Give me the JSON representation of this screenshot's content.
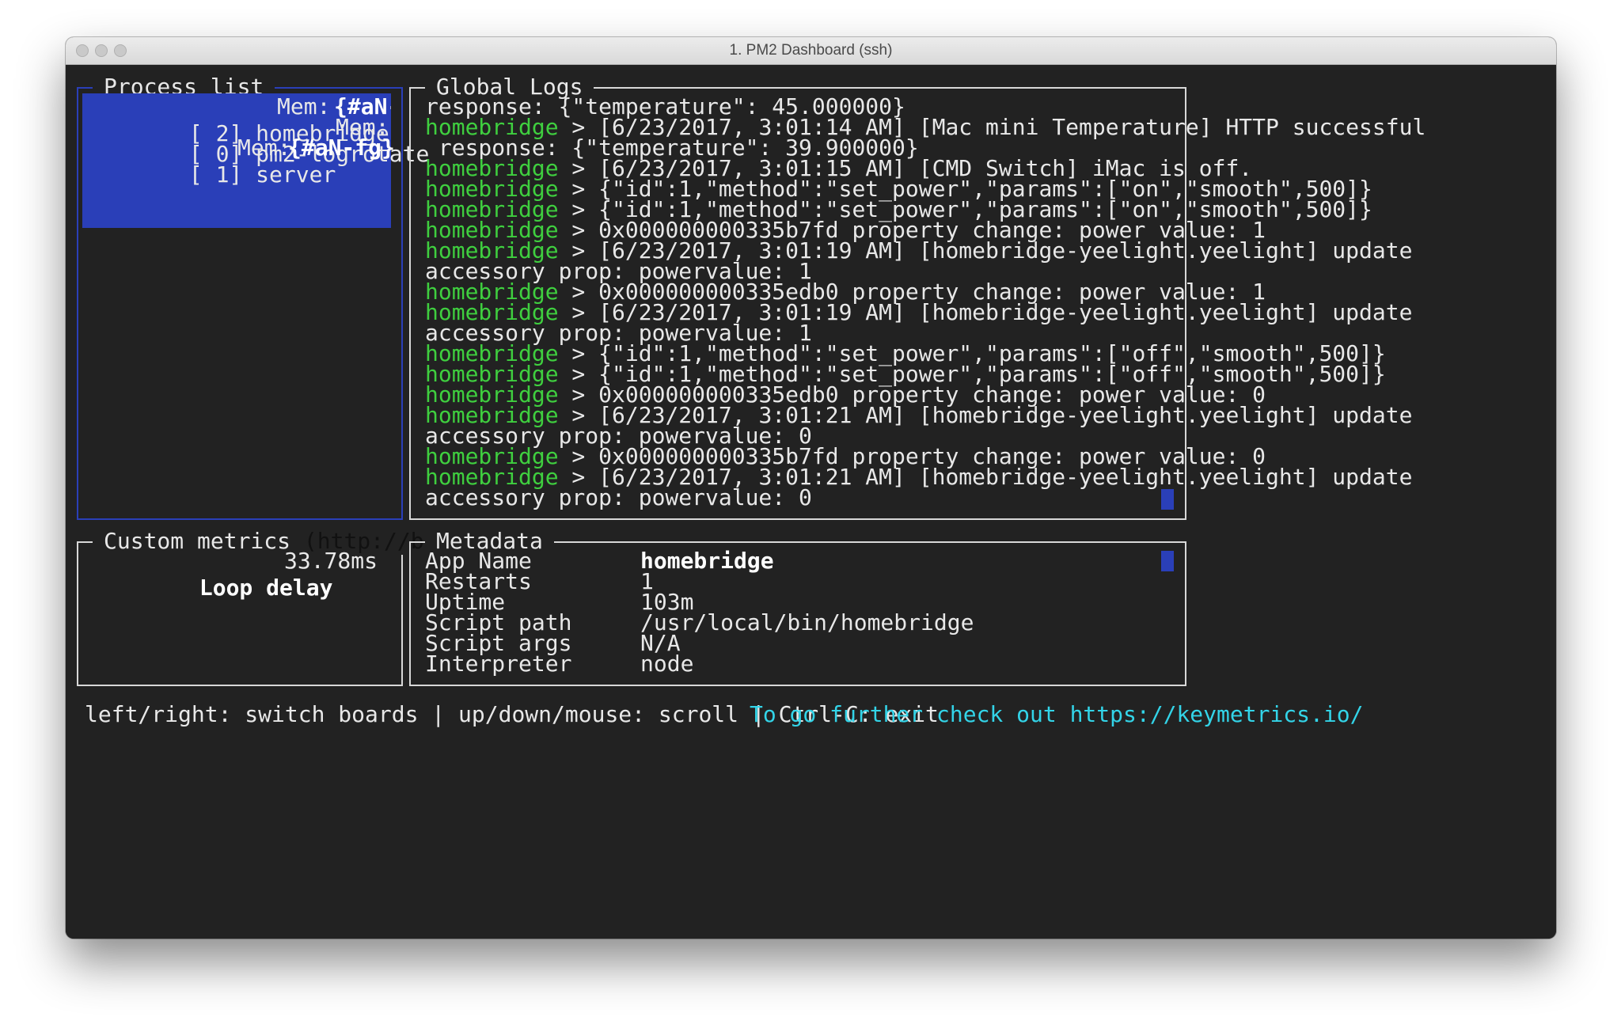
{
  "window": {
    "title": "1. PM2 Dashboard (ssh)"
  },
  "process_list": {
    "title": "Process list",
    "items": [
      {
        "id": "[ 2]",
        "name": "homebridge",
        "mem_label": "Mem:",
        "mem_value": "{#aN-f"
      },
      {
        "id": "[ 0]",
        "name": "pm2-logrotate",
        "mem_label": "Mem:",
        "mem_value": ""
      },
      {
        "id": "[ 1]",
        "name": "server",
        "mem_label": "Mem:",
        "mem_value": "{#aN-fg}"
      }
    ]
  },
  "global_logs": {
    "title": "Global Logs",
    "lines": [
      {
        "app": "",
        "text": "response: {\"temperature\": 45.000000}"
      },
      {
        "app": "homebridge",
        "text": " > [6/23/2017, 3:01:14 AM] [Mac mini Temperature] HTTP successful"
      },
      {
        "app": "",
        "text": " response: {\"temperature\": 39.900000}"
      },
      {
        "app": "homebridge",
        "text": " > [6/23/2017, 3:01:15 AM] [CMD Switch] iMac is off."
      },
      {
        "app": "homebridge",
        "text": " > {\"id\":1,\"method\":\"set_power\",\"params\":[\"on\",\"smooth\",500]}"
      },
      {
        "app": "homebridge",
        "text": " > {\"id\":1,\"method\":\"set_power\",\"params\":[\"on\",\"smooth\",500]}"
      },
      {
        "app": "homebridge",
        "text": " > 0x000000000335b7fd property change: power value: 1"
      },
      {
        "app": "homebridge",
        "text": " > [6/23/2017, 3:01:19 AM] [homebridge-yeelight.yeelight] update"
      },
      {
        "app": "",
        "text": "accessory prop: powervalue: 1"
      },
      {
        "app": "homebridge",
        "text": " > 0x000000000335edb0 property change: power value: 1"
      },
      {
        "app": "homebridge",
        "text": " > [6/23/2017, 3:01:19 AM] [homebridge-yeelight.yeelight] update"
      },
      {
        "app": "",
        "text": "accessory prop: powervalue: 1"
      },
      {
        "app": "homebridge",
        "text": " > {\"id\":1,\"method\":\"set_power\",\"params\":[\"off\",\"smooth\",500]}"
      },
      {
        "app": "homebridge",
        "text": " > {\"id\":1,\"method\":\"set_power\",\"params\":[\"off\",\"smooth\",500]}"
      },
      {
        "app": "homebridge",
        "text": " > 0x000000000335edb0 property change: power value: 0"
      },
      {
        "app": "homebridge",
        "text": " > [6/23/2017, 3:01:21 AM] [homebridge-yeelight.yeelight] update"
      },
      {
        "app": "",
        "text": "accessory prop: powervalue: 0"
      },
      {
        "app": "homebridge",
        "text": " > 0x000000000335b7fd property change: power value: 0"
      },
      {
        "app": "homebridge",
        "text": " > [6/23/2017, 3:01:21 AM] [homebridge-yeelight.yeelight] update"
      },
      {
        "app": "",
        "text": "accessory prop: powervalue: 0"
      }
    ]
  },
  "custom_metrics": {
    "title": "Custom metrics",
    "title_suffix": "(http://bit.ly",
    "items": [
      {
        "label": "Loop delay",
        "value": "33.78ms"
      }
    ]
  },
  "metadata": {
    "title": "Metadata",
    "rows": [
      {
        "key": "App Name",
        "value": "homebridge"
      },
      {
        "key": "Restarts",
        "value": "1"
      },
      {
        "key": "Uptime",
        "value": "103m"
      },
      {
        "key": "Script path",
        "value": "/usr/local/bin/homebridge"
      },
      {
        "key": "Script args",
        "value": "N/A"
      },
      {
        "key": "Interpreter",
        "value": "node"
      }
    ]
  },
  "footer": {
    "help": "left/right: switch boards | up/down/mouse: scroll | Ctrl-C: exit",
    "promo": "To go further check out https://keymetrics.io/"
  },
  "colors": {
    "terminal_bg": "#222222",
    "accent_blue": "#2a3fb8",
    "app_green": "#3fcf3f",
    "promo_cyan": "#33d4e8"
  }
}
